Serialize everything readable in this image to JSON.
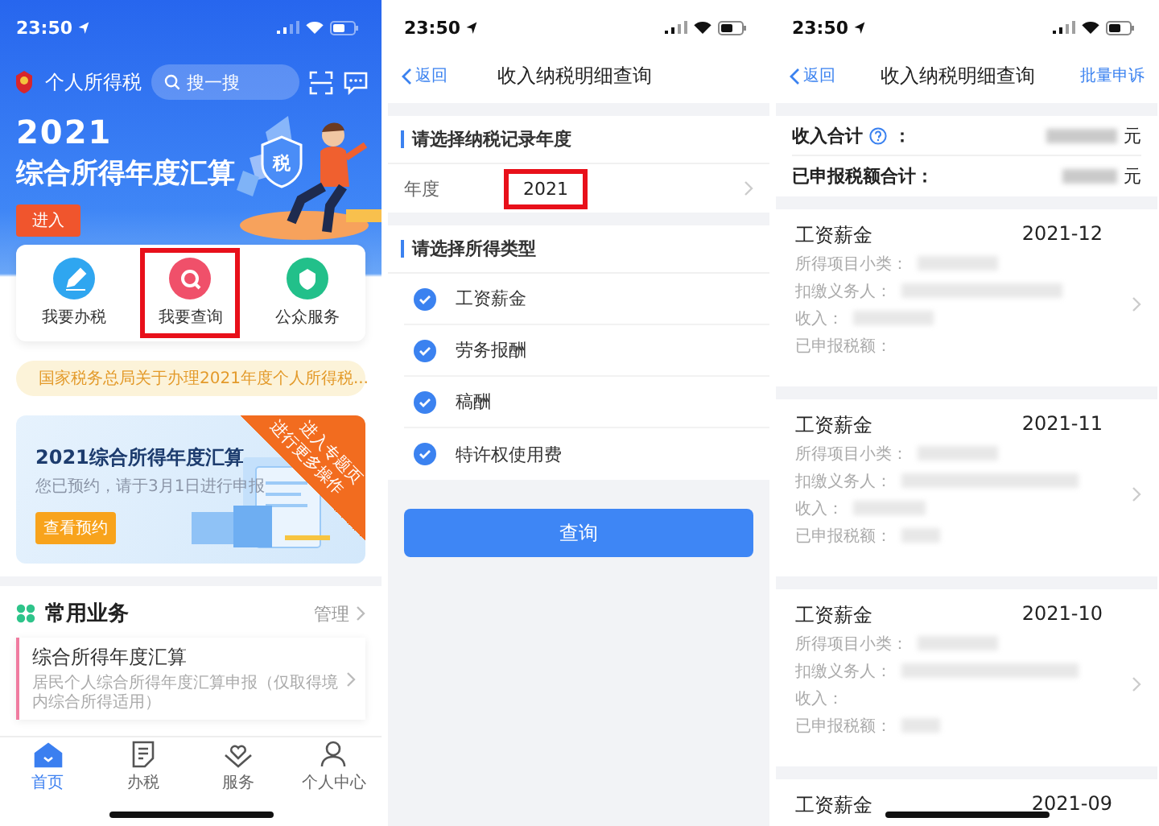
{
  "home": {
    "status_bar": {
      "time": "23:50"
    },
    "header": {
      "app_name": "个人所得税",
      "search_placeholder": "搜一搜"
    },
    "banner": {
      "year": "2021",
      "title": "综合所得年度汇算",
      "button": "进入",
      "shield_text": "税"
    },
    "quick_actions": [
      {
        "label": "我要办税",
        "color": "#2fa6f0",
        "highlighted": false
      },
      {
        "label": "我要查询",
        "color": "#f0506a",
        "highlighted": true
      },
      {
        "label": "公众服务",
        "color": "#22c08a",
        "highlighted": false
      }
    ],
    "notice": "国家税务总局关于办理2021年度个人所得税...",
    "promo": {
      "title": "2021综合所得年度汇算",
      "subtitle": "您已预约，请于3月1日进行申报",
      "button": "查看预约",
      "corner_lines": [
        "进入专题页",
        "进行更多操作"
      ]
    },
    "common": {
      "title": "常用业务",
      "manage": "管理",
      "items": [
        {
          "title": "综合所得年度汇算",
          "desc": "居民个人综合所得年度汇算申报（仅取得境内综合所得适用）"
        }
      ]
    },
    "tabbar": [
      {
        "label": "首页",
        "selected": true
      },
      {
        "label": "办税",
        "selected": false
      },
      {
        "label": "服务",
        "selected": false
      },
      {
        "label": "个人中心",
        "selected": false
      }
    ]
  },
  "query": {
    "status_bar": {
      "time": "23:50"
    },
    "nav": {
      "back": "返回",
      "title": "收入纳税明细查询"
    },
    "year_section": {
      "title": "请选择纳税记录年度",
      "label": "年度",
      "value": "2021",
      "highlighted": true
    },
    "type_section": {
      "title": "请选择所得类型",
      "options": [
        {
          "label": "工资薪金",
          "checked": true
        },
        {
          "label": "劳务报酬",
          "checked": true
        },
        {
          "label": "稿酬",
          "checked": true
        },
        {
          "label": "特许权使用费",
          "checked": true
        }
      ]
    },
    "button": "查询"
  },
  "results": {
    "status_bar": {
      "time": "23:50"
    },
    "nav": {
      "back": "返回",
      "title": "收入纳税明细查询",
      "action": "批量申诉"
    },
    "summary": [
      {
        "label": "收入合计",
        "help": true,
        "colon": "：",
        "unit": "元"
      },
      {
        "label": "已申报税额合计：",
        "help": false,
        "unit": "元"
      }
    ],
    "records": [
      {
        "type": "工资薪金",
        "date": "2021-12",
        "fields": [
          "所得项目小类：",
          "扣缴义务人：",
          "收入：",
          "已申报税额："
        ]
      },
      {
        "type": "工资薪金",
        "date": "2021-11",
        "fields": [
          "所得项目小类：",
          "扣缴义务人：",
          "收入：",
          "已申报税额："
        ]
      },
      {
        "type": "工资薪金",
        "date": "2021-10",
        "fields": [
          "所得项目小类：",
          "扣缴义务人：",
          "收入：",
          "已申报税额："
        ]
      },
      {
        "type": "工资薪金",
        "date": "2021-09"
      }
    ]
  }
}
